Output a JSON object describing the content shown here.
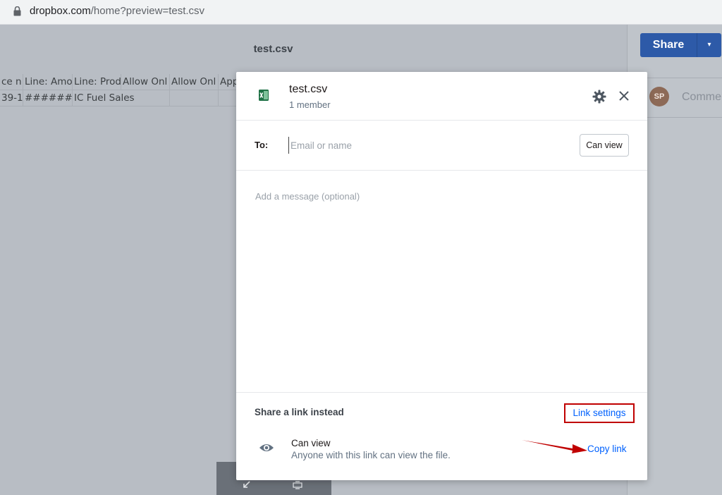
{
  "browser": {
    "url_host": "dropbox.com",
    "url_path": "/home?preview=test.csv"
  },
  "preview": {
    "title": "test.csv",
    "sheet": {
      "header_row": [
        "ce n",
        "Line: Amo",
        "Line: Prod",
        "Allow Onl",
        "Allow Onl",
        "App"
      ],
      "data_row": [
        "39-1",
        "########",
        "IC Fuel Sales",
        "",
        "",
        ""
      ]
    }
  },
  "right_panel": {
    "share_label": "Share",
    "caret": "▾",
    "avatar_initials": "SP",
    "comment_placeholder": "Comme"
  },
  "modal": {
    "file_name": "test.csv",
    "members": "1 member",
    "to_label": "To:",
    "email_placeholder": "Email or name",
    "permission_button": "Can view",
    "message_placeholder": "Add a message (optional)",
    "link_section": {
      "title": "Share a link instead",
      "settings_label": "Link settings",
      "access_title": "Can view",
      "access_desc": "Anyone with this link can view the file.",
      "copy_label": "Copy link"
    }
  },
  "colors": {
    "accent": "#0061fe",
    "share_button": "#2d5aa8",
    "highlight_box": "#c00000",
    "annotation_arrow": "#c00000",
    "excel_icon": "#1e7145"
  },
  "icons": [
    "lock-icon",
    "excel-file-icon",
    "gear-icon",
    "close-icon",
    "eye-icon",
    "arrow-annotation"
  ]
}
